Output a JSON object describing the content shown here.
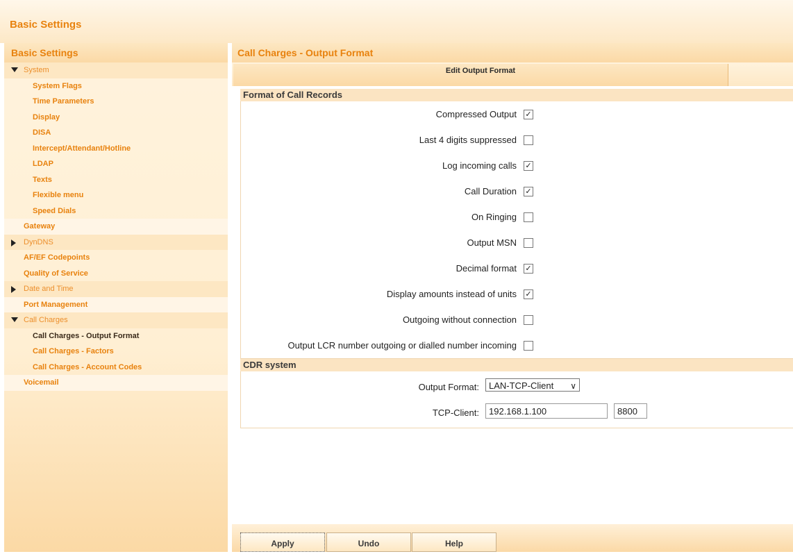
{
  "window_title": "Basic Settings",
  "sidebar": {
    "header": "Basic Settings",
    "items": [
      {
        "label": "System",
        "kind": "group",
        "expanded": true
      },
      {
        "label": "System Flags",
        "kind": "sub"
      },
      {
        "label": "Time Parameters",
        "kind": "sub"
      },
      {
        "label": "Display",
        "kind": "sub"
      },
      {
        "label": "DISA",
        "kind": "sub"
      },
      {
        "label": "Intercept/Attendant/Hotline",
        "kind": "sub"
      },
      {
        "label": "LDAP",
        "kind": "sub"
      },
      {
        "label": "Texts",
        "kind": "sub"
      },
      {
        "label": "Flexible menu",
        "kind": "sub"
      },
      {
        "label": "Speed Dials",
        "kind": "sub"
      },
      {
        "label": "Gateway",
        "kind": "top"
      },
      {
        "label": "DynDNS",
        "kind": "group",
        "expanded": false
      },
      {
        "label": "AF/EF Codepoints",
        "kind": "top"
      },
      {
        "label": "Quality of Service",
        "kind": "top"
      },
      {
        "label": "Date and Time",
        "kind": "group",
        "expanded": false
      },
      {
        "label": "Port Management",
        "kind": "top"
      },
      {
        "label": "Call Charges",
        "kind": "group",
        "expanded": true
      },
      {
        "label": "Call Charges - Output Format",
        "kind": "sub",
        "active": true
      },
      {
        "label": "Call Charges - Factors",
        "kind": "sub"
      },
      {
        "label": "Call Charges - Account Codes",
        "kind": "sub"
      },
      {
        "label": "Voicemail",
        "kind": "top"
      }
    ]
  },
  "main": {
    "title": "Call Charges - Output Format",
    "tab": "Edit Output Format",
    "format_section": {
      "title": "Format of Call Records",
      "options": [
        {
          "label": "Compressed Output",
          "checked": true
        },
        {
          "label": "Last 4 digits suppressed",
          "checked": false
        },
        {
          "label": "Log incoming calls",
          "checked": true
        },
        {
          "label": "Call Duration",
          "checked": true
        },
        {
          "label": "On Ringing",
          "checked": false
        },
        {
          "label": "Output MSN",
          "checked": false
        },
        {
          "label": "Decimal format",
          "checked": true
        },
        {
          "label": "Display amounts instead of units",
          "checked": true
        },
        {
          "label": "Outgoing without connection",
          "checked": false
        },
        {
          "label": "Output LCR number outgoing or dialled number incoming",
          "checked": false
        }
      ]
    },
    "cdr_section": {
      "title": "CDR system",
      "output_format_label": "Output Format:",
      "output_format_value": "LAN-TCP-Client",
      "tcp_client_label": "TCP-Client:",
      "tcp_ip": "192.168.1.100",
      "tcp_port": "8800"
    },
    "buttons": {
      "apply": "Apply",
      "undo": "Undo",
      "help": "Help"
    }
  },
  "colors": {
    "accent": "#e8820e",
    "panel_bg": "#fde7c2"
  }
}
